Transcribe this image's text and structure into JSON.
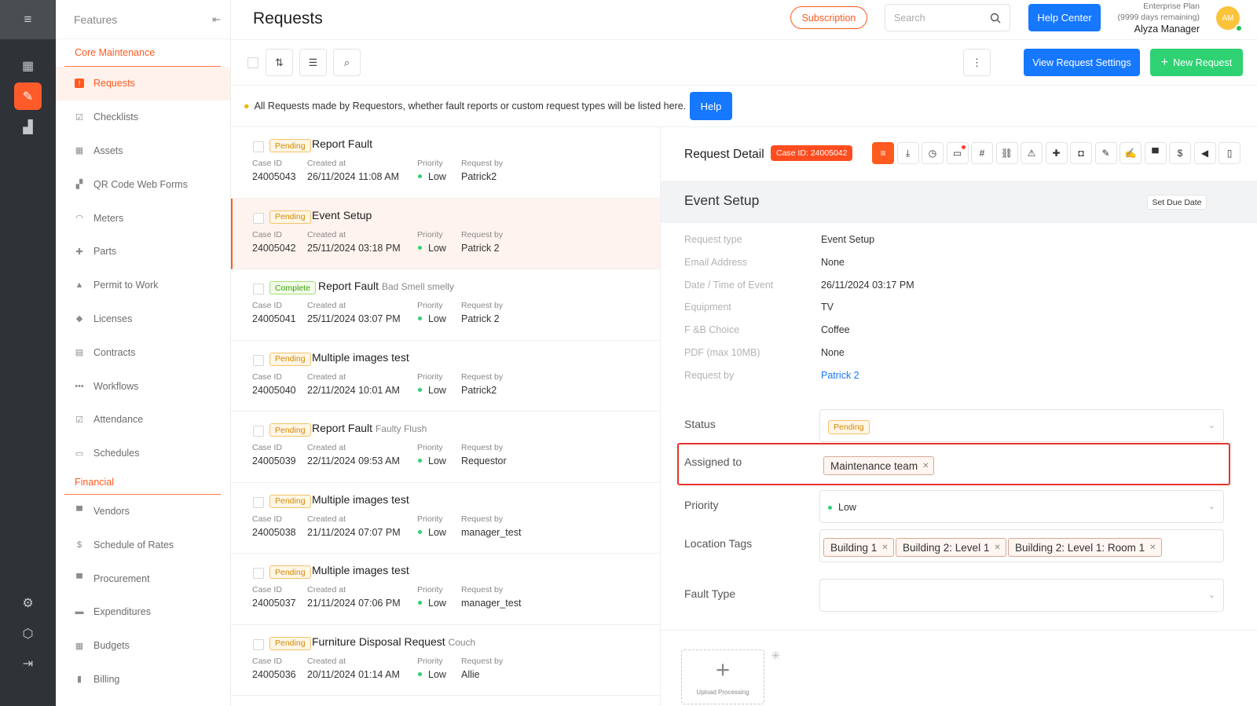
{
  "sidebar": {
    "title": "Features",
    "sections": [
      {
        "label": "Core Maintenance",
        "items": [
          {
            "label": "Requests",
            "icon": "request-icon",
            "glyph": "!",
            "active": true
          },
          {
            "label": "Checklists",
            "icon": "checklist-icon",
            "glyph": "☑"
          },
          {
            "label": "Assets",
            "icon": "assets-icon",
            "glyph": "▦"
          },
          {
            "label": "QR Code Web Forms",
            "icon": "qr-code-icon",
            "glyph": "▞"
          },
          {
            "label": "Meters",
            "icon": "meter-icon",
            "glyph": "◠"
          },
          {
            "label": "Parts",
            "icon": "parts-icon",
            "glyph": "✚"
          },
          {
            "label": "Permit to Work",
            "icon": "permit-icon",
            "glyph": "▲"
          },
          {
            "label": "Licenses",
            "icon": "license-icon",
            "glyph": "◆"
          },
          {
            "label": "Contracts",
            "icon": "contract-icon",
            "glyph": "▤"
          },
          {
            "label": "Workflows",
            "icon": "workflow-icon",
            "glyph": "•••"
          },
          {
            "label": "Attendance",
            "icon": "attendance-icon",
            "glyph": "☑"
          },
          {
            "label": "Schedules",
            "icon": "calendar-icon",
            "glyph": "▭"
          }
        ]
      },
      {
        "label": "Financial",
        "items": [
          {
            "label": "Vendors",
            "icon": "vendor-icon",
            "glyph": "▀"
          },
          {
            "label": "Schedule of Rates",
            "icon": "dollar-icon",
            "glyph": "$"
          },
          {
            "label": "Procurement",
            "icon": "procurement-icon",
            "glyph": "▀"
          },
          {
            "label": "Expenditures",
            "icon": "expenditure-icon",
            "glyph": "▬"
          },
          {
            "label": "Budgets",
            "icon": "budget-icon",
            "glyph": "▦"
          },
          {
            "label": "Billing",
            "icon": "billing-icon",
            "glyph": "▮"
          }
        ]
      }
    ]
  },
  "header": {
    "title": "Requests",
    "subscription_label": "Subscription",
    "search_placeholder": "Search",
    "help_center_label": "Help Center",
    "plan_name": "Enterprise Plan",
    "plan_remaining": "(9999 days remaining)",
    "user_name": "Alyza Manager",
    "avatar_initials": "AM"
  },
  "toolbar": {
    "view_settings_label": "View Request Settings",
    "new_request_label": "New Request"
  },
  "info": {
    "text": "All Requests made by Requestors, whether fault reports or custom request types will be listed here.",
    "help_label": "Help"
  },
  "list": {
    "meta_labels": {
      "case_id": "Case ID",
      "created_at": "Created at",
      "priority": "Priority",
      "request_by": "Request by"
    },
    "rows": [
      {
        "status": "Pending",
        "title": "Report Fault",
        "subtitle": "",
        "case_id": "24005043",
        "created_at": "26/11/2024 11:08 AM",
        "priority": "Low",
        "request_by": "Patrick2",
        "selected": false
      },
      {
        "status": "Pending",
        "title": "Event Setup",
        "subtitle": "",
        "case_id": "24005042",
        "created_at": "25/11/2024 03:18 PM",
        "priority": "Low",
        "request_by": "Patrick 2",
        "selected": true
      },
      {
        "status": "Complete",
        "title": "Report Fault",
        "subtitle": "Bad Smell smelly",
        "case_id": "24005041",
        "created_at": "25/11/2024 03:07 PM",
        "priority": "Low",
        "request_by": "Patrick 2",
        "selected": false
      },
      {
        "status": "Pending",
        "title": "Multiple images test",
        "subtitle": "",
        "case_id": "24005040",
        "created_at": "22/11/2024 10:01 AM",
        "priority": "Low",
        "request_by": "Patrick2",
        "selected": false
      },
      {
        "status": "Pending",
        "title": "Report Fault",
        "subtitle": "Faulty Flush",
        "case_id": "24005039",
        "created_at": "22/11/2024 09:53 AM",
        "priority": "Low",
        "request_by": "Requestor",
        "selected": false
      },
      {
        "status": "Pending",
        "title": "Multiple images test",
        "subtitle": "",
        "case_id": "24005038",
        "created_at": "21/11/2024 07:07 PM",
        "priority": "Low",
        "request_by": "manager_test",
        "selected": false
      },
      {
        "status": "Pending",
        "title": "Multiple images test",
        "subtitle": "",
        "case_id": "24005037",
        "created_at": "21/11/2024 07:06 PM",
        "priority": "Low",
        "request_by": "manager_test",
        "selected": false
      },
      {
        "status": "Pending",
        "title": "Furniture Disposal Request",
        "subtitle": "Couch",
        "case_id": "24005036",
        "created_at": "20/11/2024 01:14 AM",
        "priority": "Low",
        "request_by": "Allie",
        "selected": false
      }
    ]
  },
  "detail": {
    "title": "Request Detail",
    "case_badge": "Case ID: 24005042",
    "section_title": "Event Setup",
    "set_due_date_label": "Set Due Date",
    "fields": [
      {
        "key": "Request type",
        "value": "Event Setup"
      },
      {
        "key": "Email Address",
        "value": "None"
      },
      {
        "key": "Date / Time of Event",
        "value": "26/11/2024 03:17 PM"
      },
      {
        "key": "Equipment",
        "value": "TV"
      },
      {
        "key": "F &B Choice",
        "value": "Coffee"
      },
      {
        "key": "PDF (max 10MB)",
        "value": "None"
      },
      {
        "key": "Request by",
        "value": "Patrick 2",
        "link": true
      }
    ],
    "status_label": "Status",
    "status_value": "Pending",
    "assigned_label": "Assigned to",
    "assigned_tags": [
      "Maintenance team"
    ],
    "priority_label": "Priority",
    "priority_value": "Low",
    "location_label": "Location Tags",
    "location_tags": [
      "Building 1",
      "Building 2: Level 1",
      "Building 2: Level 1: Room 1"
    ],
    "fault_type_label": "Fault Type",
    "upload_label": "Upload Processing"
  },
  "colors": {
    "accent": "#ff5a1f",
    "primary": "#1677ff",
    "success": "#2ed273",
    "highlight": "#e5322d"
  }
}
